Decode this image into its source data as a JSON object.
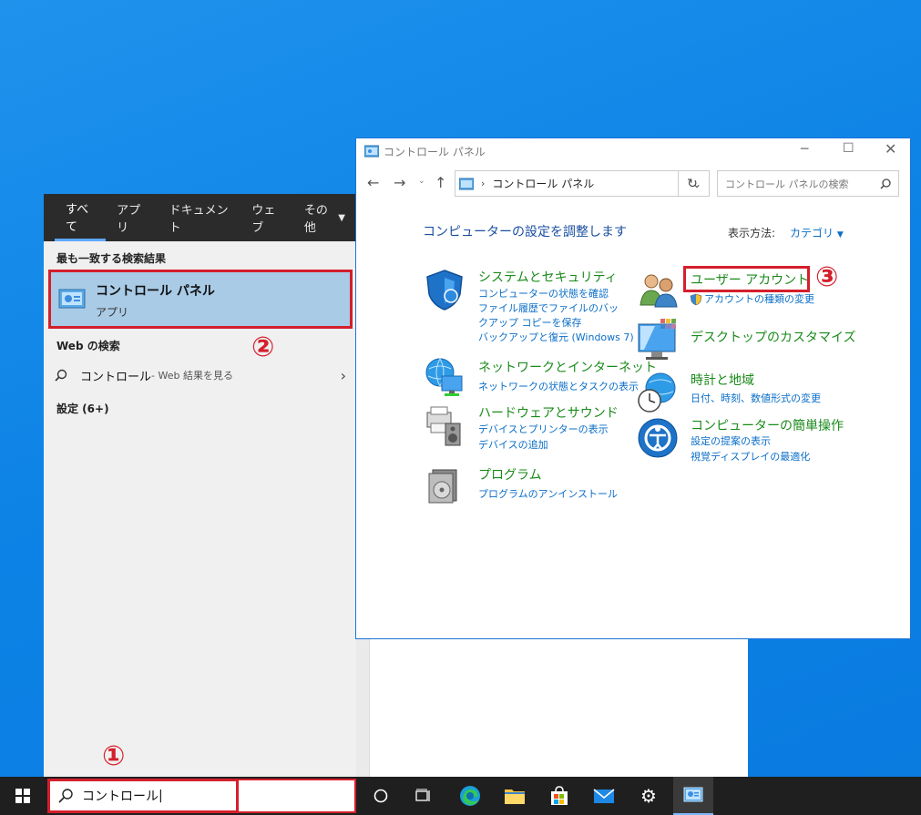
{
  "start_menu": {
    "tabs": [
      "すべて",
      "アプリ",
      "ドキュメント",
      "ウェブ",
      "その他"
    ],
    "best_match_heading": "最も一致する検索結果",
    "best_match": {
      "title": "コントロール パネル",
      "subtitle": "アプリ"
    },
    "web_heading": "Web の検索",
    "web_result": {
      "text": "コントロール",
      "suffix": " - Web 結果を見る"
    },
    "settings": "設定 (6+)"
  },
  "taskbar": {
    "search_value": "コントロール"
  },
  "annotations": {
    "one": "①",
    "two": "②",
    "three": "③"
  },
  "control_panel": {
    "window_title": "コントロール パネル",
    "address": "コントロール パネル",
    "search_placeholder": "コントロール パネルの検索",
    "heading": "コンピューターの設定を調整します",
    "view_by_label": "表示方法:",
    "view_by_value": "カテゴリ",
    "categories_left": [
      {
        "title": "システムとセキュリティ",
        "links": [
          "コンピューターの状態を確認",
          "ファイル履歴でファイルのバックアップ コピーを保存",
          "バックアップと復元 (Windows 7)"
        ]
      },
      {
        "title": "ネットワークとインターネット",
        "links": [
          "ネットワークの状態とタスクの表示"
        ]
      },
      {
        "title": "ハードウェアとサウンド",
        "links": [
          "デバイスとプリンターの表示",
          "デバイスの追加"
        ]
      },
      {
        "title": "プログラム",
        "links": [
          "プログラムのアンインストール"
        ]
      }
    ],
    "categories_right": [
      {
        "title": "ユーザー アカウント",
        "links": [
          "アカウントの種類の変更"
        ]
      },
      {
        "title": "デスクトップのカスタマイズ",
        "links": []
      },
      {
        "title": "時計と地域",
        "links": [
          "日付、時刻、数値形式の変更"
        ]
      },
      {
        "title": "コンピューターの簡単操作",
        "links": [
          "設定の提案の表示",
          "視覚ディスプレイの最適化"
        ]
      }
    ]
  },
  "colors": {
    "accent": "#0b6ec8",
    "category_green": "#1a8a1a",
    "highlight_red": "#d41f2c",
    "desktop": "#0d83e6"
  }
}
